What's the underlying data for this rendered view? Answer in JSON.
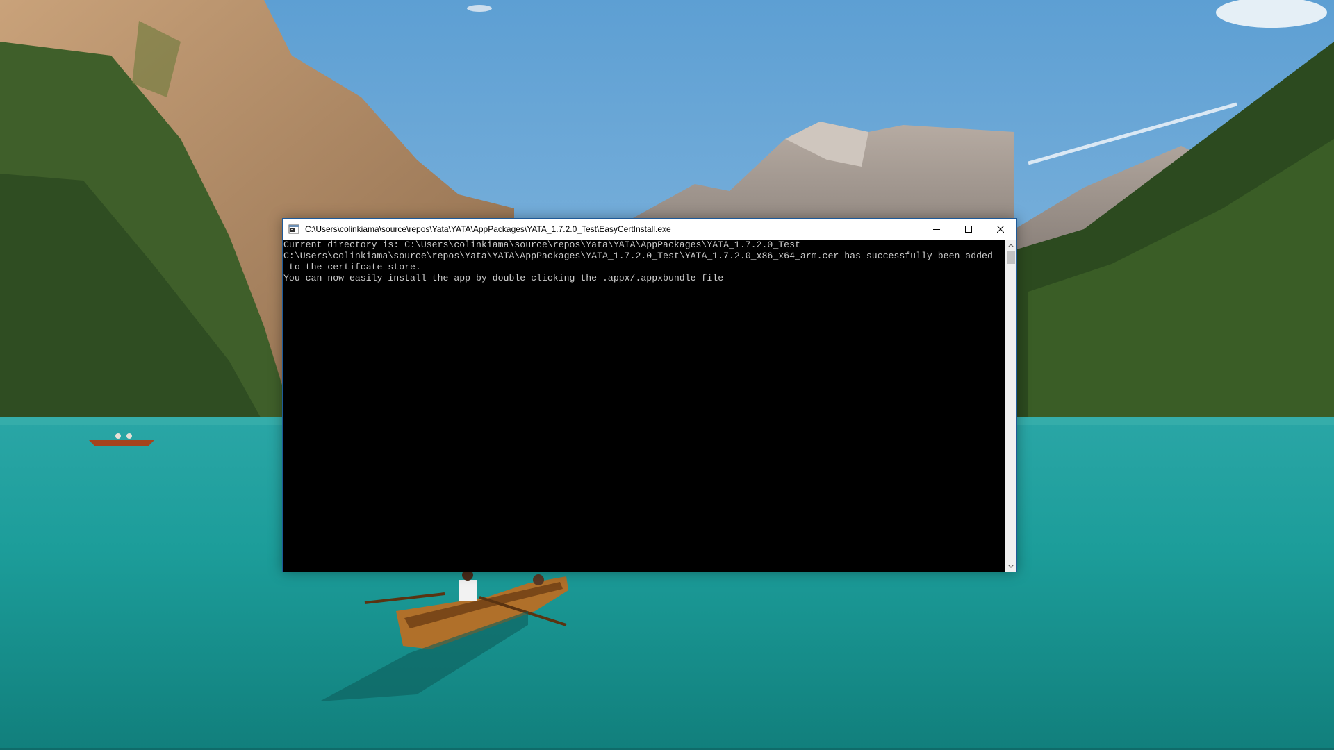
{
  "window": {
    "title": "C:\\Users\\colinkiama\\source\\repos\\Yata\\YATA\\AppPackages\\YATA_1.7.2.0_Test\\EasyCertInstall.exe",
    "icon": "console-app-icon",
    "buttons": {
      "minimize_icon": "minimize-icon",
      "maximize_icon": "maximize-icon",
      "close_icon": "close-icon"
    }
  },
  "console": {
    "lines": [
      "Current directory is: C:\\Users\\colinkiama\\source\\repos\\Yata\\YATA\\AppPackages\\YATA_1.7.2.0_Test",
      "C:\\Users\\colinkiama\\source\\repos\\Yata\\YATA\\AppPackages\\YATA_1.7.2.0_Test\\YATA_1.7.2.0_x86_x64_arm.cer has successfully been added",
      " to the certifcate store.",
      "You can now easily install the app by double clicking the .appx/.appxbundle file"
    ],
    "background": "#000000",
    "foreground": "#cccccc"
  },
  "colors": {
    "window_border": "#1e5a99",
    "title_bar": "#ffffff"
  }
}
